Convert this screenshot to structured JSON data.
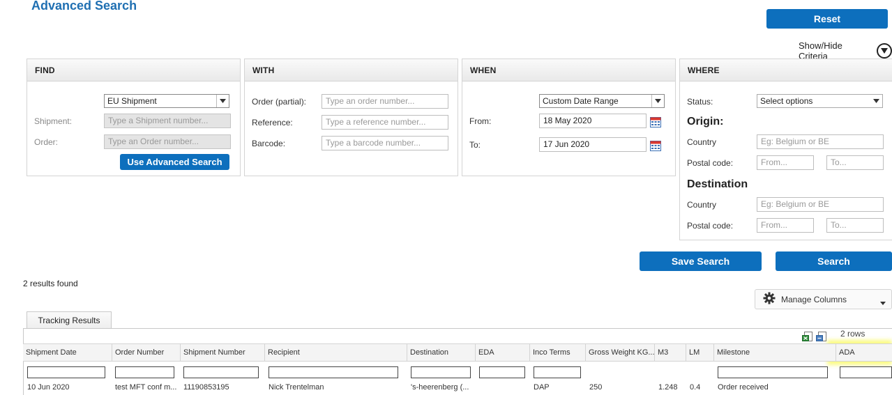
{
  "page": {
    "title": "Advanced Search",
    "reset_label": "Reset",
    "show_hide_label": "Show/Hide Criteria"
  },
  "find": {
    "header": "FIND",
    "type_select": "EU Shipment",
    "shipment_label": "Shipment:",
    "shipment_placeholder": "Type a Shipment number...",
    "order_label": "Order:",
    "order_placeholder": "Type an Order number...",
    "use_advanced_label": "Use Advanced Search"
  },
  "with": {
    "header": "WITH",
    "order_label": "Order (partial):",
    "order_placeholder": "Type an order number...",
    "reference_label": "Reference:",
    "reference_placeholder": "Type a reference number...",
    "barcode_label": "Barcode:",
    "barcode_placeholder": "Type a barcode number..."
  },
  "when": {
    "header": "WHEN",
    "range_select": "Custom Date Range",
    "from_label": "From:",
    "from_value": "18 May 2020",
    "to_label": "To:",
    "to_value": "17 Jun 2020"
  },
  "where": {
    "header": "WHERE",
    "status_label": "Status:",
    "status_placeholder": "Select options",
    "origin_title": "Origin:",
    "origin_country_label": "Country",
    "origin_country_placeholder": "Eg: Belgium or BE",
    "origin_postal_label": "Postal code:",
    "origin_from_placeholder": "From...",
    "origin_to_placeholder": "To...",
    "destination_title": "Destination",
    "dest_country_label": "Country",
    "dest_country_placeholder": "Eg: Belgium or BE",
    "dest_postal_label": "Postal code:",
    "dest_from_placeholder": "From...",
    "dest_to_placeholder": "To..."
  },
  "actions": {
    "save_search_label": "Save Search",
    "search_label": "Search"
  },
  "results": {
    "count_text": "2 results found",
    "manage_columns_label": "Manage Columns",
    "tab_label": "Tracking Results",
    "rows_text": "2 rows",
    "columns": [
      "Shipment Date",
      "Order Number",
      "Shipment Number",
      "Recipient",
      "Destination",
      "EDA",
      "Inco Terms",
      "Gross Weight KG...",
      "M3",
      "LM",
      "Milestone",
      "ADA"
    ],
    "rows": [
      [
        "10 Jun 2020",
        "test MFT conf m...",
        "11190853195",
        "Nick Trentelman",
        "'s-heerenberg (...",
        "",
        "DAP",
        "250",
        "1.248",
        "0.4",
        "Order received",
        ""
      ]
    ]
  },
  "colors": {
    "brand_blue": "#0d6fbd",
    "title_blue": "#1f6fb2",
    "highlight_yellow": "#f7f71e"
  }
}
